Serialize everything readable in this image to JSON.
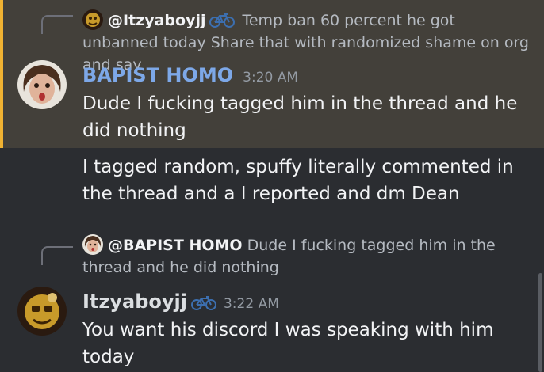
{
  "messages": [
    {
      "reply": {
        "author": "@Itzyaboyjj",
        "text": "Temp ban 60 percent he got unbanned today  Share that with randomized shame on org and say ..."
      },
      "author": "BAPIST HOMO",
      "author_color": "#7da8e8",
      "timestamp": "3:20 AM",
      "lines": [
        "Dude I fucking tagged him in the thread and he did nothing",
        "I tagged random, spuffy literally commented in the thread and a I reported and dm Dean"
      ]
    },
    {
      "reply": {
        "author": "@BAPIST HOMO",
        "text": "Dude I fucking tagged him in the thread and he did nothing"
      },
      "author": "Itzyaboyjj",
      "author_color": "#dbdee1",
      "timestamp": "3:22 AM",
      "lines": [
        "You want his discord I was speaking with him today"
      ]
    }
  ],
  "colors": {
    "highlight_bg": "#43403a",
    "highlight_bar": "#f0b232",
    "background": "#2b2d31"
  },
  "icons": {
    "badge": "bicycle-icon"
  }
}
